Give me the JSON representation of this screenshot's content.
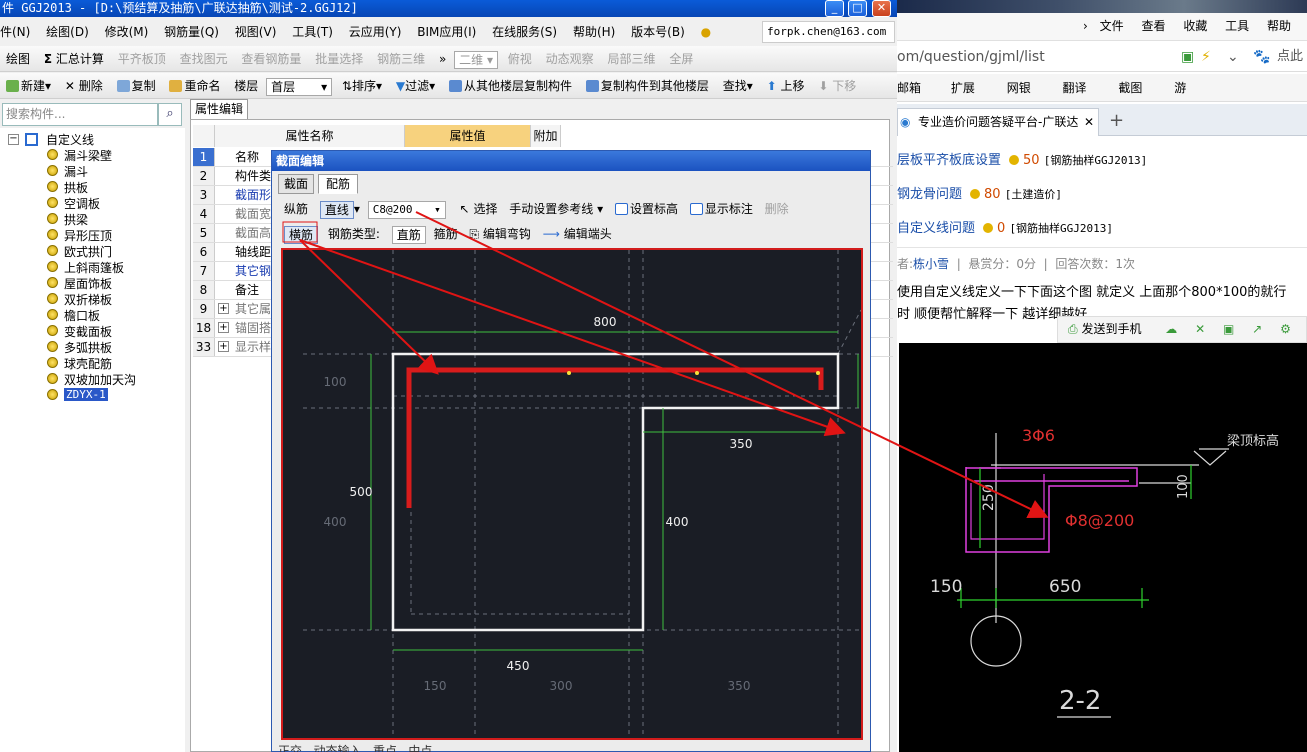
{
  "app": {
    "title": "件 GGJ2013 - [D:\\预结算及抽筋\\广联达抽筋\\测试-2.GGJ12]",
    "user": "forpk.chen@163.com",
    "menu": [
      "件(N)",
      "绘图(D)",
      "修改(M)",
      "钢筋量(Q)",
      "视图(V)",
      "工具(T)",
      "云应用(Y)",
      "BIM应用(I)",
      "在线服务(S)",
      "帮助(H)",
      "版本号(B)"
    ],
    "toolbar1": {
      "draw": "绘图",
      "sum": "汇总计算",
      "flush_top": "平齐板顶",
      "find_element": "查找图元",
      "view_rebar": "查看钢筋量",
      "batch_select": "批量选择",
      "rebar_3d": "钢筋三维",
      "view_2d": "二维",
      "top_view": "俯视",
      "dynamic_view": "动态观察",
      "local_3d": "局部三维",
      "fullscreen": "全屏"
    },
    "toolbar2": {
      "new": "新建",
      "delete": "删除",
      "copy": "复制",
      "rename": "重命名",
      "floor_label": "楼层",
      "floor_value": "首层",
      "sort": "排序",
      "filter": "过滤",
      "copy_from_floor": "从其他楼层复制构件",
      "copy_to_floor": "复制构件到其他楼层",
      "find": "查找",
      "move_up": "上移",
      "move_down": "下移"
    },
    "search_placeholder": "搜索构件..."
  },
  "tree": {
    "root": "自定义线",
    "items": [
      "漏斗梁壁",
      "漏斗",
      "拱板",
      "空调板",
      "拱梁",
      "异形压顶",
      "欧式拱门",
      "上斜雨篷板",
      "屋面饰板",
      "双折梯板",
      "檐口板",
      "变截面板",
      "多弧拱板",
      "球壳配筋",
      "双坡加加天沟",
      "ZDYX-1"
    ]
  },
  "props": {
    "tab": "属性编辑",
    "col_name": "属性名称",
    "col_value": "属性值",
    "col_extra": "附加",
    "rows": [
      {
        "num": "1",
        "name": "名称"
      },
      {
        "num": "2",
        "name": "构件类"
      },
      {
        "num": "3",
        "name": "截面形"
      },
      {
        "num": "4",
        "name": "截面宽"
      },
      {
        "num": "5",
        "name": "截面高"
      },
      {
        "num": "6",
        "name": "轴线距"
      },
      {
        "num": "7",
        "name": "其它钢"
      },
      {
        "num": "8",
        "name": "备注"
      },
      {
        "num": "9",
        "name": "其它属"
      },
      {
        "num": "18",
        "name": "锚固搭"
      },
      {
        "num": "33",
        "name": "显示样"
      }
    ]
  },
  "dialog": {
    "title": "截面编辑",
    "tab_section": "截面",
    "tab_rebar": "配筋",
    "row1": {
      "longitudinal": "纵筋",
      "line_type": "直线",
      "spec": "C8@200",
      "select": "选择",
      "manual_ref": "手动设置参考线",
      "set_elev": "设置标高",
      "show_dim": "显示标注",
      "delete": "删除"
    },
    "row2": {
      "transverse": "横筋",
      "rebar_type_label": "钢筋类型:",
      "rebar_type": "直筋",
      "stirrup": "箍筋",
      "edit_hook": "编辑弯钩",
      "edit_end": "编辑端头"
    },
    "dims": {
      "top": "800",
      "left_top": "100",
      "left_mid": "500",
      "left_low": "400",
      "right_step": "350",
      "right_h": "400",
      "bottom": "450",
      "bottom_150": "150",
      "bottom_300": "300",
      "bottom_350": "350"
    },
    "bottom_bar": [
      "正交",
      "动态输入",
      "重点",
      "中点"
    ]
  },
  "browser": {
    "menu": [
      "文件",
      "查看",
      "收藏",
      "工具",
      "帮助"
    ],
    "url": "om/question/gjml/list",
    "toolbar": [
      "邮箱",
      "扩展",
      "网银",
      "翻译",
      "截图",
      "游"
    ],
    "tab_title": "专业造价问题答疑平台-广联达",
    "questions": [
      {
        "title": "层板平齐板底设置",
        "score": "50",
        "cat": "[钢筋抽样GGJ2013]"
      },
      {
        "title": "钢龙骨问题",
        "score": "80",
        "cat": "[土建造价]"
      },
      {
        "title": "自定义线问题",
        "score": "0",
        "cat": "[钢筋抽样GGJ2013]"
      }
    ],
    "meta": {
      "author_label": "者:",
      "author": "栋小雪",
      "reward": "悬赏分：0分",
      "answers": "回答次数：1次"
    },
    "body1": "使用自定义线定义一下下面这个图 就定义 上面那个800*100的就行",
    "body2": "时   顺便帮忙解释一下 越详细越好",
    "send_to_phone": "发送到手机",
    "drawing": {
      "label_3phi6": "3Φ6",
      "label_250": "250",
      "label_100": "100",
      "label_phi8": "Φ8@200",
      "label_150": "150",
      "label_650": "650",
      "label_elev": "梁顶标高",
      "section": "2-2"
    }
  },
  "colors": {
    "titlebar": "#0746b5",
    "canvas_bg": "#1a1d25",
    "rebar_red": "#d81c1c",
    "dim_green": "#3fbf3f",
    "cad_magenta": "#e040e0"
  }
}
